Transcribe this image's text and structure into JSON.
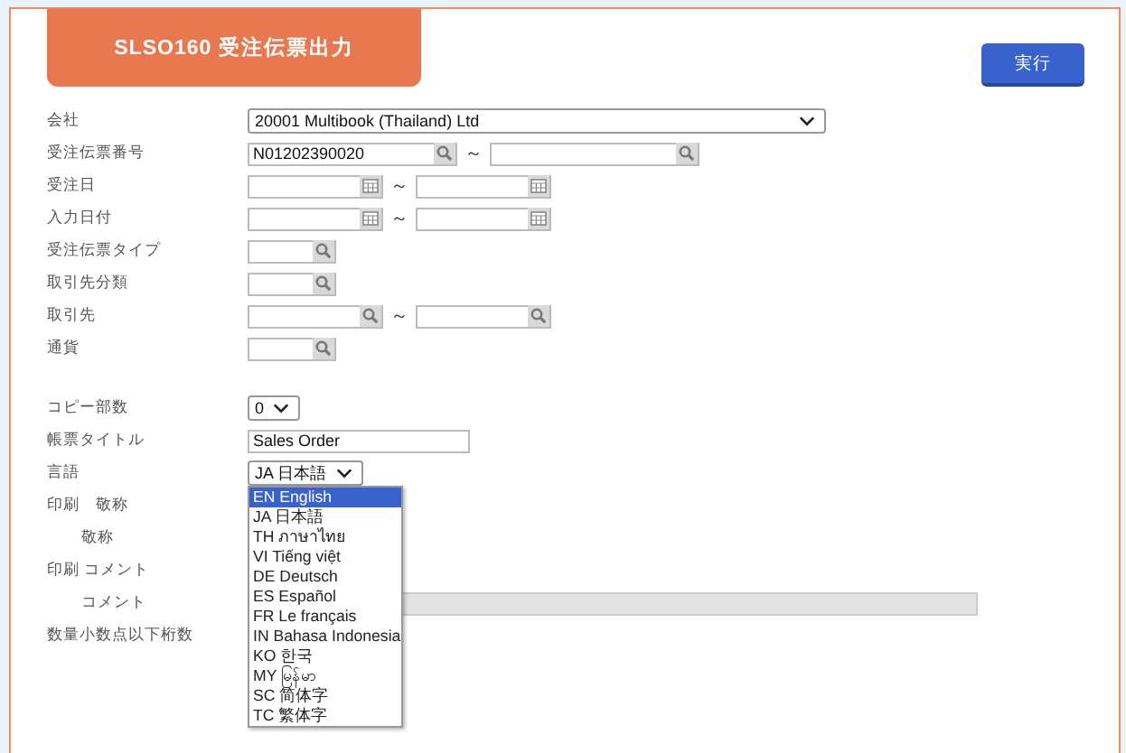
{
  "title": "SLSO160 受注伝票出力",
  "run_button": "実行",
  "sections": [
    {
      "fields": [
        {
          "kind": "select",
          "label": "会社",
          "value": "20001 Multibook (Thailand) Ltd"
        },
        {
          "kind": "wide_lookup_range",
          "label": "受注伝票番号",
          "from": "N01202390020",
          "separator": "～"
        },
        {
          "kind": "date_range",
          "label": "受注日",
          "separator": "～"
        },
        {
          "kind": "date_range",
          "label": "入力日付",
          "separator": "～"
        },
        {
          "kind": "lookup",
          "label": "受注伝票タイプ"
        },
        {
          "kind": "lookup",
          "label": "取引先分類"
        },
        {
          "kind": "lookup_range",
          "label": "取引先",
          "separator": "～"
        },
        {
          "kind": "lookup",
          "label": "通貨"
        }
      ]
    },
    {
      "fields": [
        {
          "kind": "small_select",
          "label": "コピー部数",
          "value": "0"
        },
        {
          "kind": "text",
          "label": "帳票タイトル",
          "value": "Sales Order"
        },
        {
          "kind": "dropdown",
          "label": "言語",
          "value": "JA 日本語",
          "expanded": true,
          "options": [
            {
              "label": "EN English",
              "highlighted": true
            },
            {
              "label": "JA 日本語",
              "highlighted": false
            },
            {
              "label": "TH ภาษาไทย",
              "highlighted": false
            },
            {
              "label": "VI Tiếng việt",
              "highlighted": false
            },
            {
              "label": "DE Deutsch",
              "highlighted": false
            },
            {
              "label": "ES Español",
              "highlighted": false
            },
            {
              "label": "FR Le français",
              "highlighted": false
            },
            {
              "label": "IN Bahasa Indonesia",
              "highlighted": false
            },
            {
              "label": "KO 한국",
              "highlighted": false
            },
            {
              "label": "MY မြန်မာ",
              "highlighted": false
            },
            {
              "label": "SC 简体字",
              "highlighted": false
            },
            {
              "label": "TC 繁体字",
              "highlighted": false
            }
          ]
        },
        {
          "kind": "label",
          "label": "印刷　敬称",
          "indented": false
        },
        {
          "kind": "label",
          "label": "敬称",
          "indented": true
        },
        {
          "kind": "label",
          "label": "印刷 コメント",
          "indented": false
        },
        {
          "kind": "disabled_text",
          "label": "コメント",
          "indented": true
        },
        {
          "kind": "label",
          "label": "数量小数点以下桁数",
          "indented": false
        }
      ]
    }
  ]
}
